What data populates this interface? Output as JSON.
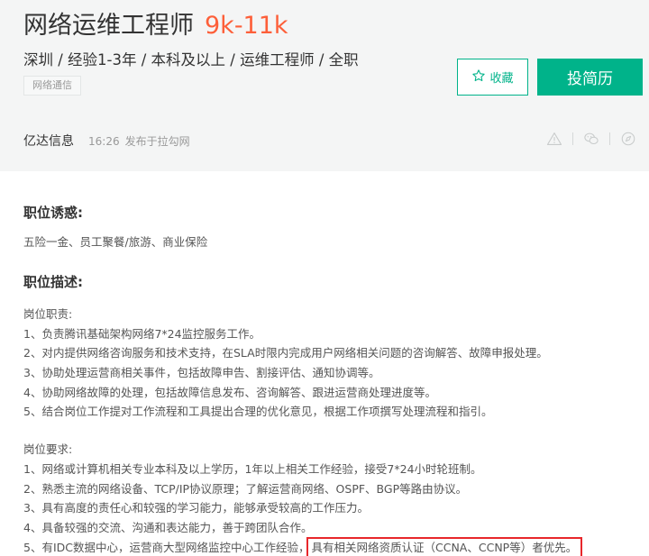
{
  "job": {
    "title": "网络运维工程师",
    "salary": "9k-11k",
    "subtitle": "深圳 / 经验1-3年 / 本科及以上 / 运维工程师 / 全职",
    "tag": "网络通信"
  },
  "actions": {
    "favorite_label": "收藏",
    "apply_label": "投简历"
  },
  "meta": {
    "company": "亿达信息",
    "time": "16:26",
    "published": "发布于拉勾网"
  },
  "perks": {
    "heading": "职位诱惑:",
    "text": "五险一金、员工聚餐/旅游、商业保险"
  },
  "description": {
    "heading": "职位描述:",
    "duties_title": "岗位职责:",
    "duties": [
      "1、负责腾讯基础架构网络7*24监控服务工作。",
      "2、对内提供网络咨询服务和技术支持，在SLA时限内完成用户网络相关问题的咨询解答、故障申报处理。",
      "3、协助处理运营商相关事件，包括故障申告、割接评估、通知协调等。",
      "4、协助网络故障的处理，包括故障信息发布、咨询解答、跟进运营商处理进度等。",
      "5、结合岗位工作提对工作流程和工具提出合理的优化意见，根据工作项撰写处理流程和指引。"
    ],
    "requirements_title": "岗位要求:",
    "requirements": [
      "1、网络或计算机相关专业本科及以上学历，1年以上相关工作经验，接受7*24小时轮班制。",
      "2、熟悉主流的网络设备、TCP/IP协议原理；了解运营商网络、OSPF、BGP等路由协议。",
      "3、具有高度的责任心和较强的学习能力，能够承受较高的工作压力。",
      "4、具备较强的交流、沟通和表达能力，善于跨团队合作。"
    ],
    "requirement_5_prefix": "5、有IDC数据中心，运营商大型网络监控中心工作经验，",
    "requirement_5_highlight": "具有相关网络资质认证（CCNA、CCNP等）者优先。"
  },
  "icons": [
    "warning-icon",
    "wechat-icon",
    "compass-icon",
    "star-icon"
  ],
  "colors": {
    "accent": "#00b38a",
    "salary": "#fd5f39",
    "highlight_box": "#e8272b",
    "header_bg": "#f4f5f5"
  }
}
